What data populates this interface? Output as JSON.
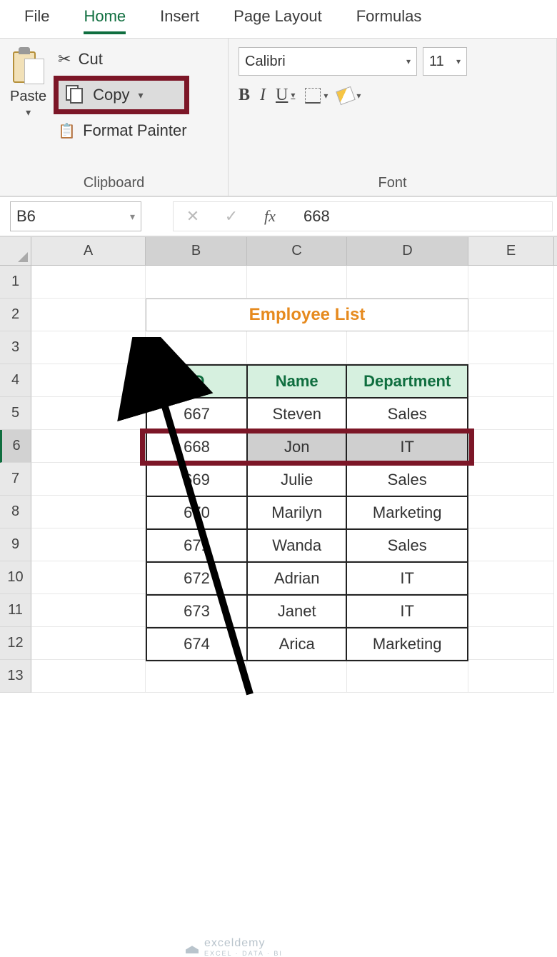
{
  "tabs": {
    "file": "File",
    "home": "Home",
    "insert": "Insert",
    "pagelayout": "Page Layout",
    "formulas": "Formulas"
  },
  "clipboard": {
    "paste": "Paste",
    "cut": "Cut",
    "copy": "Copy",
    "format_painter": "Format Painter",
    "group_label": "Clipboard"
  },
  "font": {
    "name": "Calibri",
    "size": "11",
    "bold": "B",
    "italic": "I",
    "underline": "U",
    "group_label": "Font"
  },
  "namebox": "B6",
  "formula_value": "668",
  "columns": [
    "A",
    "B",
    "C",
    "D",
    "E"
  ],
  "row_numbers": [
    1,
    2,
    3,
    4,
    5,
    6,
    7,
    8,
    9,
    10,
    11,
    12,
    13
  ],
  "title": "Employee List",
  "headers": {
    "id": "ID",
    "name": "Name",
    "dept": "Department"
  },
  "chart_data": {
    "type": "table",
    "columns": [
      "ID",
      "Name",
      "Department"
    ],
    "rows": [
      [
        667,
        "Steven",
        "Sales"
      ],
      [
        668,
        "Jon",
        "IT"
      ],
      [
        669,
        "Julie",
        "Sales"
      ],
      [
        670,
        "Marilyn",
        "Marketing"
      ],
      [
        671,
        "Wanda",
        "Sales"
      ],
      [
        672,
        "Adrian",
        "IT"
      ],
      [
        673,
        "Janet",
        "IT"
      ],
      [
        674,
        "Arica",
        "Marketing"
      ]
    ],
    "selected_row_index": 1
  },
  "watermark": {
    "brand": "exceldemy",
    "sub": "EXCEL · DATA · BI"
  }
}
